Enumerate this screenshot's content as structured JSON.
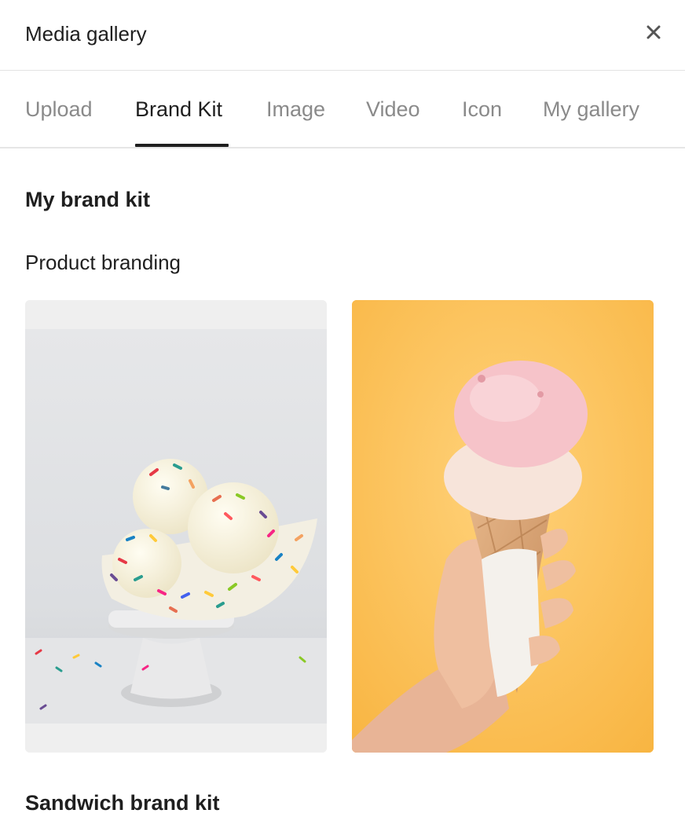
{
  "dialog": {
    "title": "Media gallery",
    "close_icon": "close-icon"
  },
  "tabs": [
    {
      "label": "Upload",
      "active": false
    },
    {
      "label": "Brand Kit",
      "active": true
    },
    {
      "label": "Image",
      "active": false
    },
    {
      "label": "Video",
      "active": false
    },
    {
      "label": "Icon",
      "active": false
    },
    {
      "label": "My gallery",
      "active": false
    }
  ],
  "content": {
    "section_title": "My brand kit",
    "subsection_title": "Product branding",
    "images": [
      {
        "name": "ice-cream-sprinkle-bowl-image",
        "description_icon": "photo"
      },
      {
        "name": "ice-cream-cone-image",
        "description_icon": "photo"
      }
    ],
    "next_section_title": "Sandwich brand kit"
  },
  "colors": {
    "text_primary": "#1f1f1f",
    "text_muted": "#8a8a8a",
    "accent_underline": "#1f1f1f",
    "yellow_background": "#fbbe50"
  }
}
